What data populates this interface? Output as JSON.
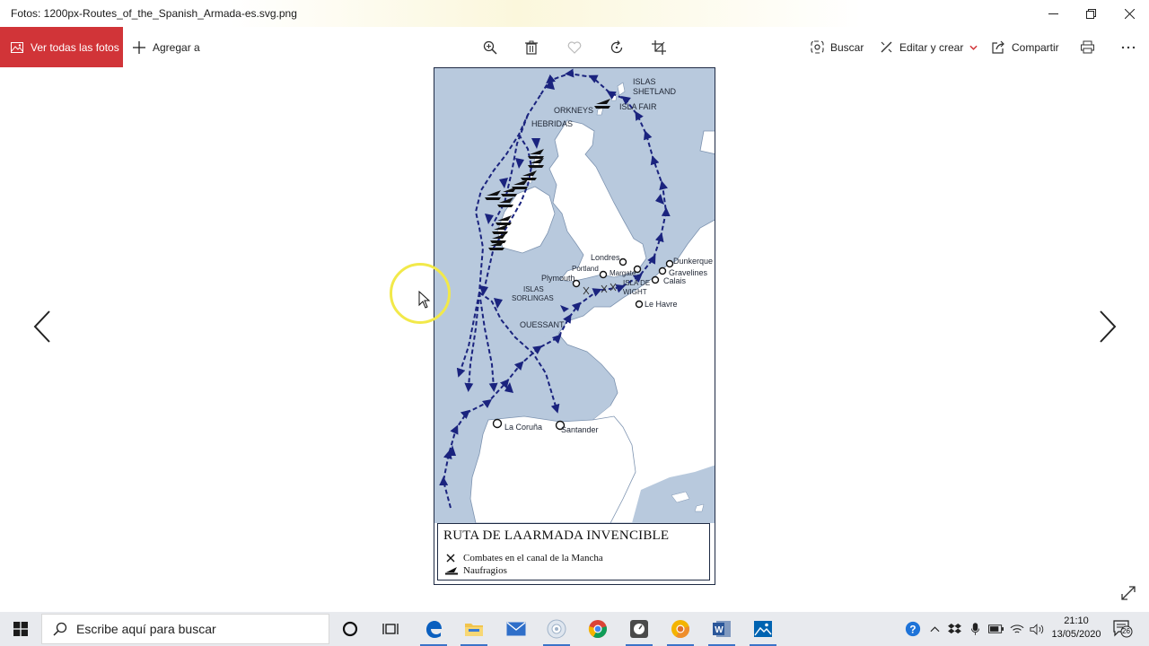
{
  "window": {
    "title": "Fotos: 1200px-Routes_of_the_Spanish_Armada-es.svg.png"
  },
  "toolbar": {
    "all_photos_label": "Ver todas las fotos",
    "add_to_label": "Agregar a",
    "search_label": "Buscar",
    "edit_create_label": "Editar y crear",
    "share_label": "Compartir"
  },
  "map": {
    "labels": {
      "shetland": "ISLAS\nSHETLAND",
      "shetland_1": "ISLAS",
      "shetland_2": "SHETLAND",
      "orkneys": "ORKNEYS",
      "fair": "ISLA FAIR",
      "hebridas": "HEBRIDAS",
      "londres": "Londres",
      "portland": "Portland",
      "margate": "Margate",
      "dunkerque": "Dunkerque",
      "gravelines": "Gravelines",
      "calais": "Calais",
      "plymouth": "Plymouth",
      "wight_1": "ISLA DE",
      "wight_2": "WIGHT",
      "sorlingas_1": "ISLAS",
      "sorlingas_2": "SORLINGAS",
      "le_havre": "Le Havre",
      "ouessant": "OUESSANT",
      "coruna": "La Coruña",
      "santander": "Santander"
    },
    "legend": {
      "title": "RUTA DE  LAARMADA INVENCIBLE",
      "combat": "Combates en el canal de la Mancha",
      "wreck": "Naufragios"
    },
    "colors": {
      "sea": "#b8c9dd",
      "land": "#ffffff",
      "route": "#1a237e"
    }
  },
  "taskbar": {
    "search_placeholder": "Escribe aquí para buscar",
    "time": "21:10",
    "date": "13/05/2020",
    "notifications": "26"
  },
  "colors": {
    "accent": "#d13438",
    "taskbar_bg": "#e8eaee"
  }
}
